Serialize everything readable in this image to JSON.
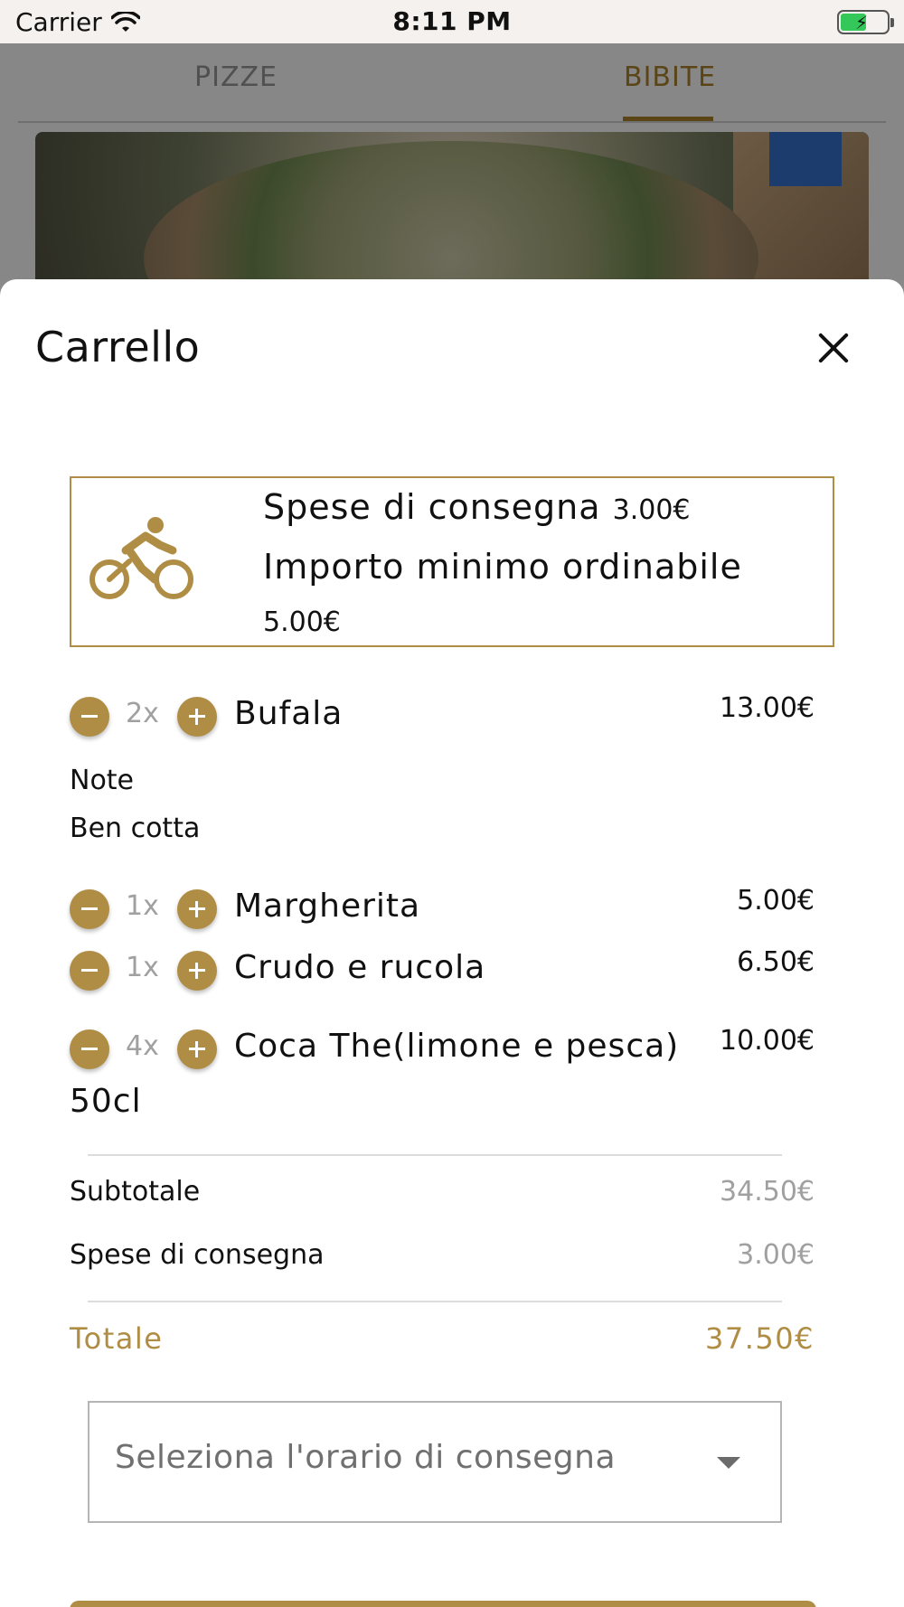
{
  "statusbar": {
    "carrier": "Carrier",
    "time": "8:11 PM"
  },
  "tabs": [
    {
      "label": "PIZZE",
      "active": false
    },
    {
      "label": "BIBITE",
      "active": true
    }
  ],
  "cart": {
    "title": "Carrello",
    "delivery": {
      "fee_label": "Spese di consegna",
      "fee_value": "3.00€",
      "min_label": "Importo minimo ordinabile",
      "min_value": "5.00€"
    },
    "items": [
      {
        "qty": "2x",
        "name": "Bufala",
        "price": "13.00€",
        "note_label": "Note",
        "note": "Ben cotta"
      },
      {
        "qty": "1x",
        "name": "Margherita",
        "price": "5.00€"
      },
      {
        "qty": "1x",
        "name": "Crudo e rucola",
        "price": "6.50€"
      },
      {
        "qty": "4x",
        "name": "Coca The(limone e pesca)",
        "name_cont": "50cl",
        "price": "10.00€"
      }
    ],
    "summary": {
      "subtotal_label": "Subtotale",
      "subtotal_value": "34.50€",
      "delivery_label": "Spese di consegna",
      "delivery_value": "3.00€",
      "total_label": "Totale",
      "total_value": "37.50€"
    },
    "time_select": {
      "placeholder": "Seleziona l'orario di consegna"
    }
  },
  "colors": {
    "accent": "#b08d44",
    "muted": "#a0a0a0"
  },
  "icons": [
    "wifi-icon",
    "battery-icon",
    "close-icon",
    "bicycle-icon",
    "minus-icon",
    "plus-icon",
    "chevron-down-icon"
  ]
}
